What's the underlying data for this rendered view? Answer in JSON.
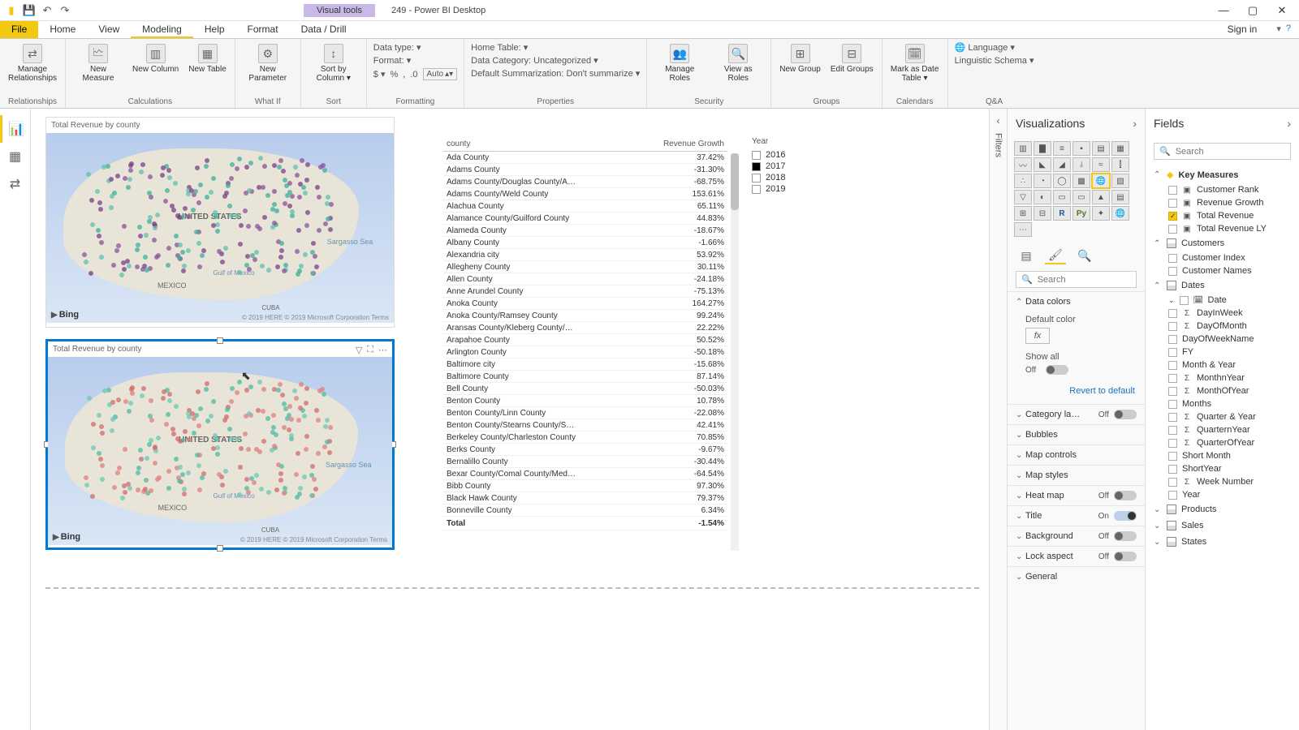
{
  "app": {
    "title": "249 - Power BI Desktop",
    "visual_tools": "Visual tools",
    "signin": "Sign in"
  },
  "win": {
    "min": "—",
    "max": "▢",
    "close": "✕"
  },
  "tabs": {
    "file": "File",
    "home": "Home",
    "view": "View",
    "modeling": "Modeling",
    "help": "Help",
    "format": "Format",
    "datadrill": "Data / Drill"
  },
  "ribbon": {
    "relationships": {
      "manage": "Manage\nRelationships",
      "group": "Relationships"
    },
    "calculations": {
      "measure": "New\nMeasure",
      "column": "New\nColumn",
      "table": "New\nTable",
      "group": "Calculations"
    },
    "whatif": {
      "param": "New\nParameter",
      "group": "What If"
    },
    "sort": {
      "sortby": "Sort by\nColumn ▾",
      "group": "Sort"
    },
    "formatting": {
      "datatype": "Data type:  ▾",
      "format": "Format:  ▾",
      "currency": "$ ▾",
      "percent": "%",
      "comma": ",",
      "decimals": ".0",
      "auto": "Auto",
      "group": "Formatting"
    },
    "properties": {
      "hometable": "Home Table:  ▾",
      "datacat": "Data Category: Uncategorized ▾",
      "summ": "Default Summarization: Don't summarize ▾",
      "group": "Properties"
    },
    "security": {
      "manage": "Manage\nRoles",
      "viewas": "View as\nRoles",
      "group": "Security"
    },
    "groups": {
      "new": "New\nGroup",
      "edit": "Edit\nGroups",
      "group": "Groups"
    },
    "calendars": {
      "mark": "Mark as\nDate Table ▾",
      "group": "Calendars"
    },
    "qa": {
      "lang": "Language ▾",
      "schema": "Linguistic Schema ▾",
      "group": "Q&A"
    }
  },
  "canvas": {
    "map1_title": "Total Revenue by county",
    "map2_title": "Total Revenue by county",
    "bing": "Bing",
    "credit": "© 2019 HERE © 2019 Microsoft Corporation  Terms",
    "us": "UNITED STATES",
    "mexico": "MEXICO",
    "sargasso": "Sargasso Sea",
    "gulf": "Gulf of\nMexico",
    "cuba": "CUBA"
  },
  "table": {
    "col_county": "county",
    "col_growth": "Revenue Growth",
    "rows": [
      {
        "c": "Ada County",
        "v": "37.42%"
      },
      {
        "c": "Adams County",
        "v": "-31.30%"
      },
      {
        "c": "Adams County/Douglas County/A…",
        "v": "-68.75%"
      },
      {
        "c": "Adams County/Weld County",
        "v": "153.61%"
      },
      {
        "c": "Alachua County",
        "v": "65.11%"
      },
      {
        "c": "Alamance County/Guilford County",
        "v": "44.83%"
      },
      {
        "c": "Alameda County",
        "v": "-18.67%"
      },
      {
        "c": "Albany County",
        "v": "-1.66%"
      },
      {
        "c": "Alexandria city",
        "v": "53.92%"
      },
      {
        "c": "Allegheny County",
        "v": "30.11%"
      },
      {
        "c": "Allen County",
        "v": "-24.18%"
      },
      {
        "c": "Anne Arundel County",
        "v": "-75.13%"
      },
      {
        "c": "Anoka County",
        "v": "164.27%"
      },
      {
        "c": "Anoka County/Ramsey County",
        "v": "99.24%"
      },
      {
        "c": "Aransas County/Kleberg County/…",
        "v": "22.22%"
      },
      {
        "c": "Arapahoe County",
        "v": "50.52%"
      },
      {
        "c": "Arlington County",
        "v": "-50.18%"
      },
      {
        "c": "Baltimore city",
        "v": "-15.68%"
      },
      {
        "c": "Baltimore County",
        "v": "87.14%"
      },
      {
        "c": "Bell County",
        "v": "-50.03%"
      },
      {
        "c": "Benton County",
        "v": "10.78%"
      },
      {
        "c": "Benton County/Linn County",
        "v": "-22.08%"
      },
      {
        "c": "Benton County/Stearns County/S…",
        "v": "42.41%"
      },
      {
        "c": "Berkeley County/Charleston County",
        "v": "70.85%"
      },
      {
        "c": "Berks County",
        "v": "-9.67%"
      },
      {
        "c": "Bernalillo County",
        "v": "-30.44%"
      },
      {
        "c": "Bexar County/Comal County/Med…",
        "v": "-64.54%"
      },
      {
        "c": "Bibb County",
        "v": "97.30%"
      },
      {
        "c": "Black Hawk County",
        "v": "79.37%"
      },
      {
        "c": "Bonneville County",
        "v": "6.34%"
      }
    ],
    "total_label": "Total",
    "total_value": "-1.54%"
  },
  "slicer": {
    "title": "Year",
    "items": [
      {
        "label": "2016",
        "checked": false
      },
      {
        "label": "2017",
        "checked": true
      },
      {
        "label": "2018",
        "checked": false
      },
      {
        "label": "2019",
        "checked": false
      }
    ]
  },
  "filters": {
    "label": "Filters"
  },
  "viz": {
    "title": "Visualizations",
    "search": "Search",
    "format": {
      "data_colors": "Data colors",
      "default_color": "Default color",
      "fx": "fx",
      "show_all": "Show all",
      "revert": "Revert to default",
      "category_labels": "Category la…",
      "bubbles": "Bubbles",
      "map_controls": "Map controls",
      "map_styles": "Map styles",
      "heat_map": "Heat map",
      "title_section": "Title",
      "background": "Background",
      "lock_aspect": "Lock aspect",
      "general": "General",
      "off": "Off",
      "on": "On"
    }
  },
  "fields": {
    "title": "Fields",
    "search": "Search",
    "groups": {
      "key_measures": "Key Measures",
      "customers": "Customers",
      "dates": "Dates",
      "products": "Products",
      "sales": "Sales",
      "states": "States"
    },
    "km": {
      "customer_rank": "Customer Rank",
      "revenue_growth": "Revenue Growth",
      "total_revenue": "Total Revenue",
      "total_revenue_ly": "Total Revenue LY"
    },
    "cust": {
      "index": "Customer Index",
      "names": "Customer Names"
    },
    "dates": {
      "date": "Date",
      "dayinweek": "DayInWeek",
      "dayofmonth": "DayOfMonth",
      "dayofweekname": "DayOfWeekName",
      "fy": "FY",
      "monthyear": "Month & Year",
      "monthnyear": "MonthnYear",
      "monthofyear": "MonthOfYear",
      "months": "Months",
      "quarteryear": "Quarter & Year",
      "quarternyear": "QuarternYear",
      "quarterofyear": "QuarterOfYear",
      "shortmonth": "Short Month",
      "shortyear": "ShortYear",
      "weeknumber": "Week Number",
      "year": "Year"
    }
  }
}
